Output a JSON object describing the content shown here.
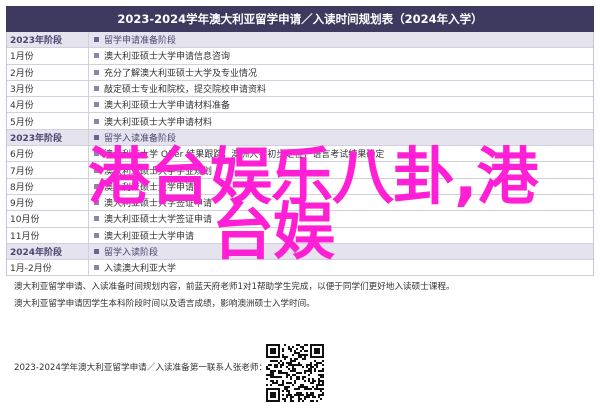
{
  "title": "2023-2024学年澳大利亚留学申请／入读时间规划表（2024年入学）",
  "rows": [
    {
      "type": "section",
      "month": "2023年阶段",
      "desc": "留学申请准备阶段"
    },
    {
      "type": "plain",
      "month": "1月份",
      "desc": "澳大利亚硕士大学申请信息咨询"
    },
    {
      "type": "plain",
      "month": "2月份",
      "desc": "充分了解澳大利亚硕士大学及专业情况"
    },
    {
      "type": "plain",
      "month": "3月份",
      "desc": "敲定硕士专业和院校，提交院校申请资料"
    },
    {
      "type": "plain",
      "month": "4月份",
      "desc": "澳大利亚硕士大学申请材料准备"
    },
    {
      "type": "plain",
      "month": "5月份",
      "desc": "澳大利亚硕士大学申请材料"
    },
    {
      "type": "section",
      "month": "2023年阶段",
      "desc": "留学入读准备阶段"
    },
    {
      "type": "plain",
      "month": "6月份",
      "desc": "澳大利亚大学 Offer 结果跟踪，澳洲大学初步定位，语言考试结果确定"
    },
    {
      "type": "plain",
      "month": "7月份",
      "desc": "澳大利亚硕士大学学业规划"
    },
    {
      "type": "plain",
      "month": "8月份",
      "desc": "澳大利亚硕士大学申请"
    },
    {
      "type": "plain",
      "month": "9月份",
      "desc": "澳大利亚硕士大学签证申请"
    },
    {
      "type": "plain",
      "month": "10月份",
      "desc": "澳大利亚硕士大学签证申请"
    },
    {
      "type": "plain",
      "month": "11月份",
      "desc": "澳大利亚硕士大学申请"
    },
    {
      "type": "section",
      "month": "2024年阶段",
      "desc": "留学入读阶段"
    },
    {
      "type": "plain",
      "month": "1月-2月份",
      "desc": "入读澳大利亚大学"
    }
  ],
  "notes": [
    "澳大利亚留学申请、入读准备时间规划内容，前蓝天府老师1对1帮助学生完成，以便于同学们更好地入读硕士课程。",
    "澳大利亚留学申请因学生本科阶段时间以及语言成绩，影响澳洲硕士入学时间。"
  ],
  "footer": "2023-2024学年澳大利亚留学申请／入读准备第一联系人张老师：",
  "overlay": {
    "line1": "港台娱乐八卦,港",
    "line2": "台娱"
  },
  "colors": {
    "header_bg": "#3e3a5f",
    "section_bg": "#e4e3ee",
    "overlay_text": "#ff1fd4"
  }
}
